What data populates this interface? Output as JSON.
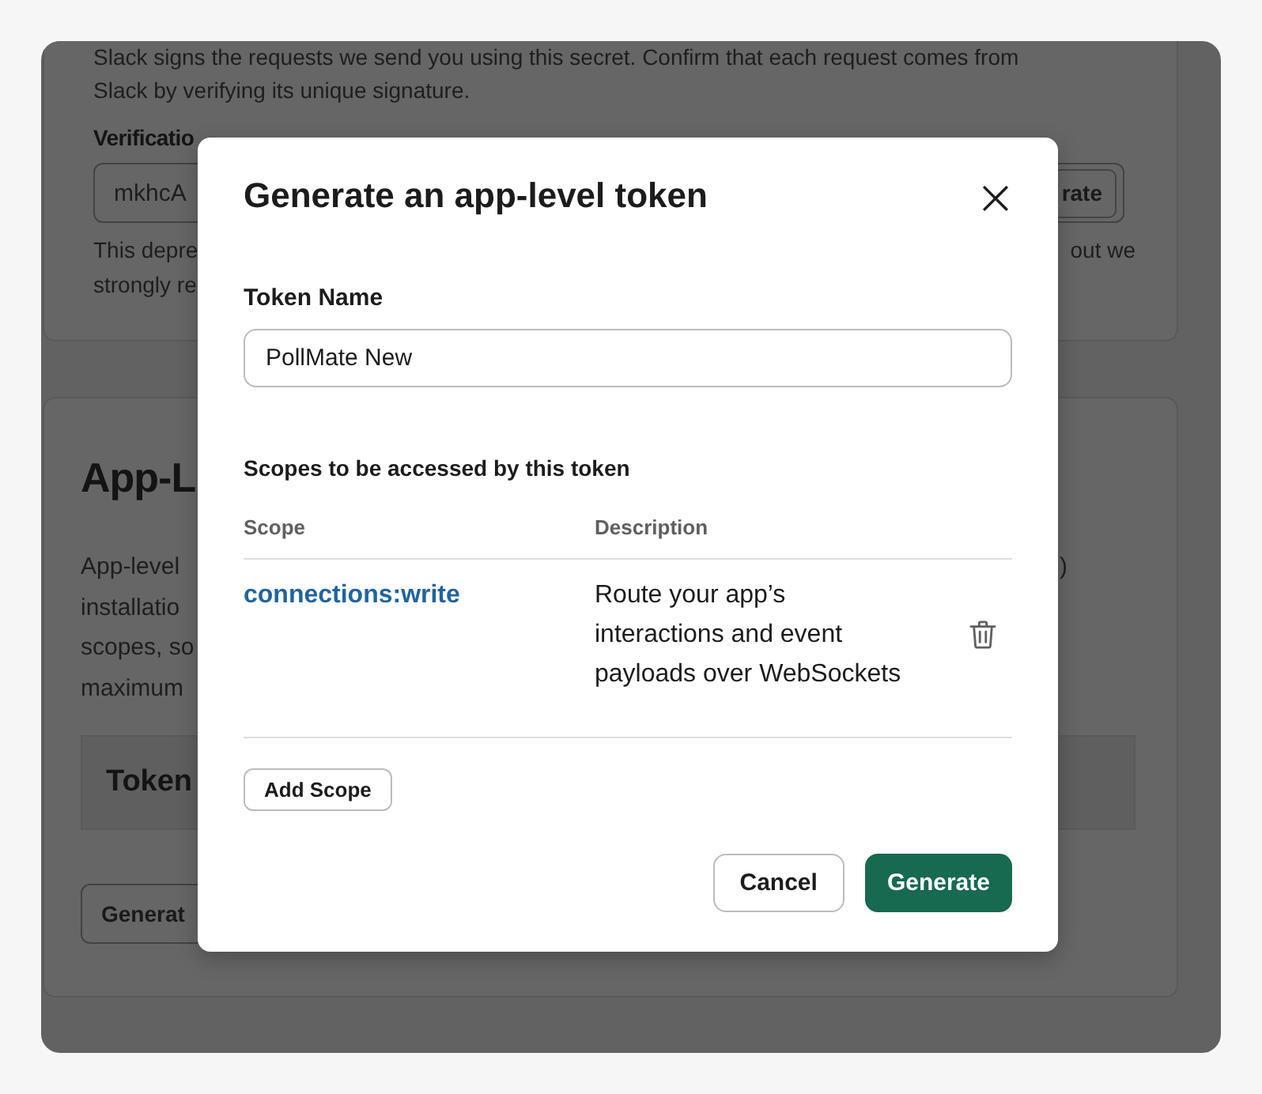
{
  "background": {
    "app_credentials": {
      "description": "Slack signs the requests we send you using this secret. Confirm that each request comes from Slack by verifying its unique signature.",
      "verification_token": {
        "label": "Verificatio",
        "value": "mkhcA",
        "button": "rate"
      },
      "note_lines": [
        {
          "left": "This depre",
          "right": "out we"
        },
        {
          "left": "strongly re"
        }
      ]
    },
    "app_level_tokens": {
      "title": "App-L",
      "text_lines": [
        {
          "left": "App-level",
          "right": ")"
        },
        {
          "left": "installatio"
        },
        {
          "left": "scopes, so"
        },
        {
          "left": "maximum"
        }
      ],
      "table_heading": "Token",
      "button": "Generat"
    }
  },
  "modal": {
    "title": "Generate an app-level token",
    "token_name": {
      "label": "Token Name",
      "value": "PollMate New"
    },
    "scopes_label": "Scopes to be accessed by this token",
    "columns": [
      "Scope",
      "Description"
    ],
    "scopes": [
      {
        "scope": "connections:write",
        "description": "Route your app’s interactions and event payloads over WebSockets"
      }
    ],
    "add_button": "Add Scope",
    "buttons": [
      {
        "label": "Cancel",
        "kind": "secondary"
      },
      {
        "label": "Generate",
        "kind": "primary"
      }
    ]
  }
}
